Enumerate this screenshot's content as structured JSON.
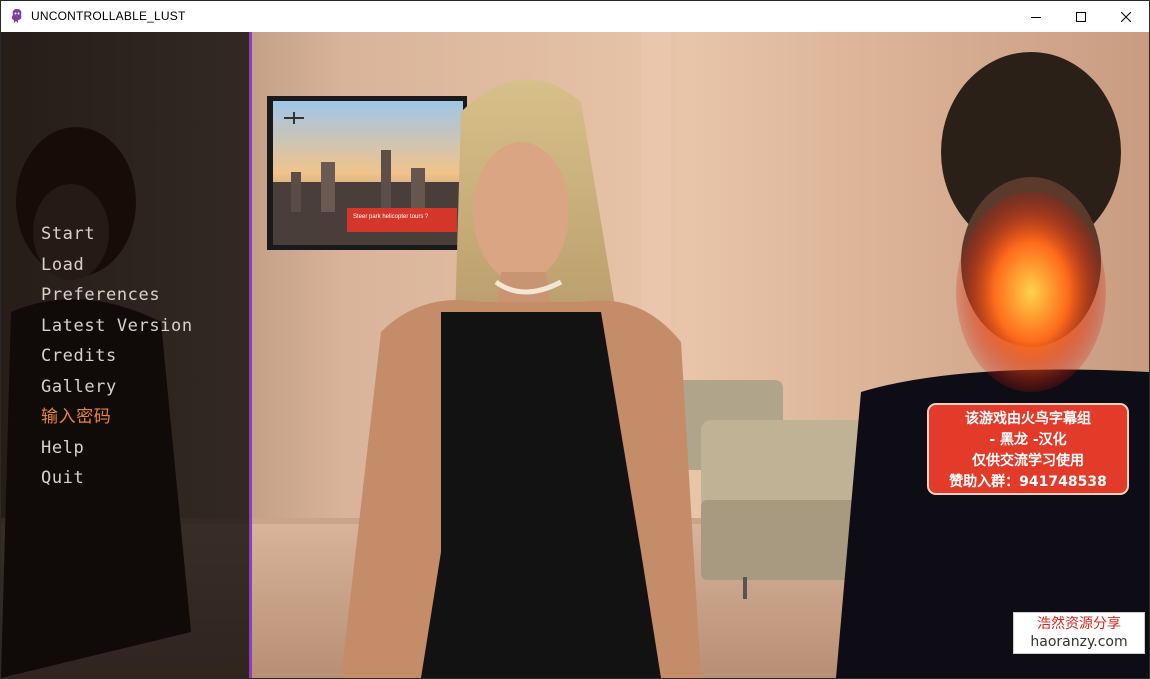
{
  "window": {
    "title": "UNCONTROLLABLE_LUST"
  },
  "menu": {
    "items": [
      {
        "label": "Start"
      },
      {
        "label": "Load"
      },
      {
        "label": "Preferences"
      },
      {
        "label": "Latest Version"
      },
      {
        "label": "Credits"
      },
      {
        "label": "Gallery"
      },
      {
        "label": "输入密码"
      },
      {
        "label": "Help"
      },
      {
        "label": "Quit"
      }
    ],
    "accent_color": "#e8843a",
    "border_color": "#8a3fbf"
  },
  "tv_screen": {
    "headline": "Steer park helicopter tours ?"
  },
  "badge": {
    "line1": "该游戏由火鸟字幕组",
    "line2": "- 黑龙 -汉化",
    "line3": "仅供交流学习使用",
    "line4": "赞助入群：941748538",
    "color": "#e23b2a"
  },
  "watermark": {
    "line1": "浩然资源分享",
    "line2": "haoranzy.com"
  }
}
